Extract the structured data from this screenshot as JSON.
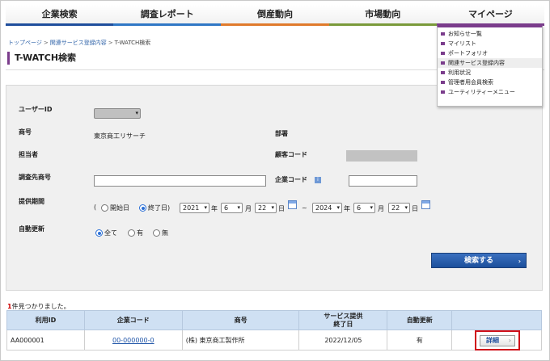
{
  "nav": {
    "items": [
      "企業検索",
      "調査レポート",
      "倒産動向",
      "市場動向",
      "マイページ"
    ],
    "colors": [
      "#1f4e9c",
      "#2f77c5",
      "#e07a2b",
      "#7a9a3a",
      "#7b3d8c"
    ]
  },
  "breadcrumb": {
    "items": [
      "トップページ",
      "関連サービス登録内容",
      "T-WATCH検索"
    ]
  },
  "page_title": "T-WATCH検索",
  "mypage_menu": {
    "items": [
      "お知らせ一覧",
      "マイリスト",
      "ポートフォリオ",
      "関連サービス登録内容",
      "利用状況",
      "管理者用会員検索",
      "ユーティリティーメニュー"
    ],
    "active_index": 3
  },
  "form": {
    "user_id_label": "ユーザーID",
    "company_name_label": "商号",
    "company_name_value": "東京商工リサーチ",
    "department_label": "部署",
    "person_label": "担当者",
    "customer_code_label": "顧客コード",
    "survey_name_label": "調査先商号",
    "company_code_label": "企業コード",
    "period_label": "提供期間",
    "paren_open": "(",
    "start_date_label": "開始日",
    "end_date_label": "終了日)",
    "from": {
      "year": "2021",
      "month": "6",
      "day": "22"
    },
    "to": {
      "year": "2024",
      "month": "6",
      "day": "22"
    },
    "year_unit": "年",
    "month_unit": "月",
    "day_unit": "日",
    "tilde": "~",
    "auto_update_label": "自動更新",
    "auto_update_options": [
      "全て",
      "有",
      "無"
    ],
    "auto_update_selected": 0,
    "search_button": "検索する"
  },
  "results": {
    "count": "1",
    "count_suffix": "件見つかりました。",
    "headers": [
      "利用ID",
      "企業コード",
      "商号",
      "サービス提供\n終了日",
      "自動更新",
      ""
    ],
    "rows": [
      {
        "usage_id": "AA000001",
        "company_code": "00-000000-0",
        "company_name": "(株) 東京商工製作所",
        "end_date": "2022/12/05",
        "auto_update": "有",
        "detail_label": "詳細"
      }
    ]
  },
  "icons": {
    "chevron": "›",
    "calendar": "calendar-icon",
    "info": "info-icon",
    "select_arrow": "▾"
  }
}
